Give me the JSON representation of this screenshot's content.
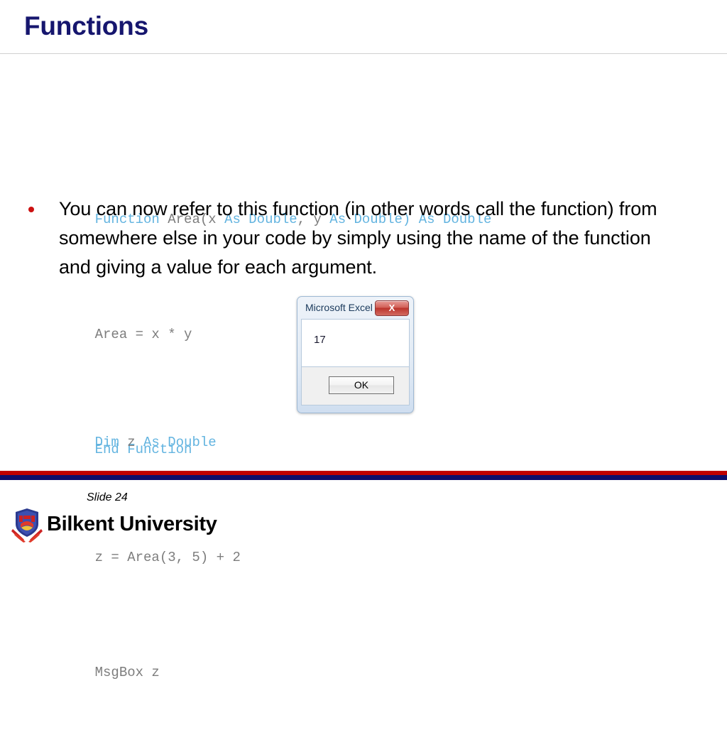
{
  "slide": {
    "title": "Functions",
    "number_label": "Slide 24"
  },
  "code_block_1": {
    "lines": [
      [
        {
          "text": "Function ",
          "kind": "keyword"
        },
        {
          "text": "Area(x ",
          "kind": "identifier"
        },
        {
          "text": "As Double",
          "kind": "keyword"
        },
        {
          "text": ", y ",
          "kind": "identifier"
        },
        {
          "text": "As Double)",
          "kind": "keyword"
        },
        {
          "text": " ",
          "kind": "identifier"
        },
        {
          "text": "As Double",
          "kind": "keyword"
        }
      ],
      [
        {
          "text": "Area = x * y",
          "kind": "identifier"
        }
      ],
      [
        {
          "text": "End Function",
          "kind": "keyword"
        }
      ]
    ],
    "plain_text": "Function Area(x As Double, y As Double) As Double\n\nArea = x * y\n\nEnd Function"
  },
  "code_block_2": {
    "lines": [
      [
        {
          "text": "Dim ",
          "kind": "keyword"
        },
        {
          "text": "z ",
          "kind": "identifier"
        },
        {
          "text": "As Double",
          "kind": "keyword"
        }
      ],
      [
        {
          "text": "z = Area(3, 5) + 2",
          "kind": "identifier"
        }
      ],
      [
        {
          "text": "MsgBox z",
          "kind": "identifier"
        }
      ]
    ],
    "plain_text": "Dim z As Double\n\nz = Area(3, 5) + 2\n\nMsgBox z"
  },
  "bullet": {
    "marker": "bullet-dot",
    "text": "You can now refer to this function (in other words call the function) from somewhere else in your code by simply using the name of the function and giving a value for each argument."
  },
  "msgbox": {
    "title": "Microsoft Excel",
    "close_label": "X",
    "message": "17",
    "ok_label": "OK"
  },
  "brand": {
    "name": "Bilkent University",
    "logo_name": "bilkent-shield-logo"
  },
  "colors": {
    "title_navy": "#16166e",
    "code_keyword_blue": "#63b4e0",
    "code_identifier_gray": "#7d7d7d",
    "bullet_red": "#cc1111",
    "footer_red": "#c00000",
    "footer_navy": "#0d0d6b",
    "msgbox_close_red": "#bb342c"
  }
}
